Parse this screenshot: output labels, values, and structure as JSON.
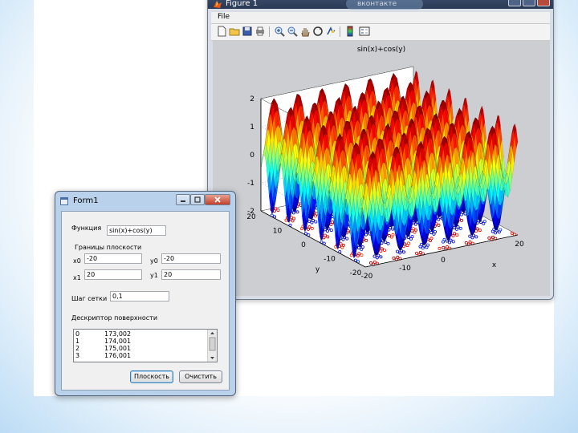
{
  "figure_window": {
    "title": "Figure 1",
    "background_search_hint": "вконтакте",
    "menu": {
      "file": "File"
    },
    "toolbar_icons": [
      "new-file-icon",
      "open-folder-icon",
      "save-icon",
      "print-icon",
      "zoom-in-icon",
      "zoom-out-icon",
      "pan-hand-icon",
      "rotate-3d-icon",
      "data-cursor-icon",
      "colorbar-icon",
      "legend-icon"
    ]
  },
  "chart_data": {
    "type": "surface",
    "title": "sin(x)+cos(y)",
    "function": "sin(x)+cos(y)",
    "xlabel": "x",
    "ylabel": "y",
    "zlabel": "",
    "xlim": [
      -20,
      20
    ],
    "ylim": [
      -20,
      20
    ],
    "zlim": [
      -2,
      2
    ],
    "x_ticks": [
      "-20",
      "-10",
      "0",
      "20"
    ],
    "y_ticks": [
      "20",
      "10",
      "0",
      "-10",
      "-20"
    ],
    "z_ticks": [
      "2",
      "1",
      "0",
      "-1",
      "-2"
    ],
    "colormap": "jet",
    "grid": true
  },
  "form_window": {
    "title": "Form1",
    "function_label": "Функция",
    "function_value": "sin(x)+cos(y)",
    "bounds_label": "Границы плоскости",
    "x0_label": "x0",
    "x0_value": "-20",
    "y0_label": "y0",
    "y0_value": "-20",
    "x1_label": "x1",
    "x1_value": "20",
    "y1_label": "y1",
    "y1_value": "20",
    "step_label": "Шаг сетки",
    "step_value": "0,1",
    "descriptor_label": "Дескриптор поверхности",
    "descriptor_rows": [
      {
        "index": "0",
        "value": "173,002"
      },
      {
        "index": "1",
        "value": "174,001"
      },
      {
        "index": "2",
        "value": "175,001"
      },
      {
        "index": "3",
        "value": "176,001"
      }
    ],
    "plane_button": "Плоскость",
    "clear_button": "Очистить"
  }
}
